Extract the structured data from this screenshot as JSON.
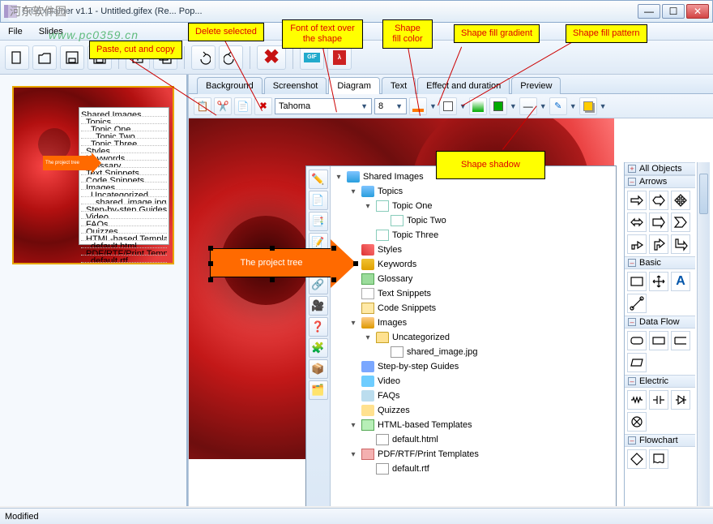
{
  "window": {
    "title": "Gif-Explainer v1.1 - Untitled.gifex (Re...                    Pop..."
  },
  "watermarks": {
    "w1": "河东软件园",
    "w2": "www.pc0359.cn"
  },
  "menu": {
    "file": "File",
    "slides": "Slides"
  },
  "tabs": {
    "background": "Background",
    "screenshot": "Screenshot",
    "diagram": "Diagram",
    "text": "Text",
    "effect": "Effect and duration",
    "preview": "Preview"
  },
  "subtoolbar": {
    "font": "Tahoma",
    "size": "8"
  },
  "tree": {
    "root": "Shared Images",
    "topics": "Topics",
    "topic_one": "Topic One",
    "topic_two": "Topic Two",
    "topic_three": "Topic Three",
    "styles": "Styles",
    "keywords": "Keywords",
    "glossary": "Glossary",
    "text_snippets": "Text Snippets",
    "code_snippets": "Code Snippets",
    "images": "Images",
    "uncategorized": "Uncategorized",
    "shared_image": "shared_image.jpg",
    "steps": "Step-by-step Guides",
    "video": "Video",
    "faqs": "FAQs",
    "quizzes": "Quizzes",
    "html_tpl": "HTML-based Templates",
    "default_html": "default.html",
    "pdf_tpl": "PDF/RTF/Print Templates",
    "default_rtf": "default.rtf"
  },
  "arrow_label": "The project tree",
  "callouts": {
    "paste": "Paste, cut and copy",
    "delete": "Delete selected",
    "font": "Font of text over the shape",
    "fill_color": "Shape fill color",
    "fill_gradient": "Shape fill gradient",
    "fill_pattern": "Shape fill pattern",
    "shadow": "Shape shadow"
  },
  "right_panel": {
    "all": "All Objects",
    "arrows": "Arrows",
    "basic": "Basic",
    "dataflow": "Data Flow",
    "electric": "Electric",
    "flowchart": "Flowchart"
  },
  "status": "Modified"
}
